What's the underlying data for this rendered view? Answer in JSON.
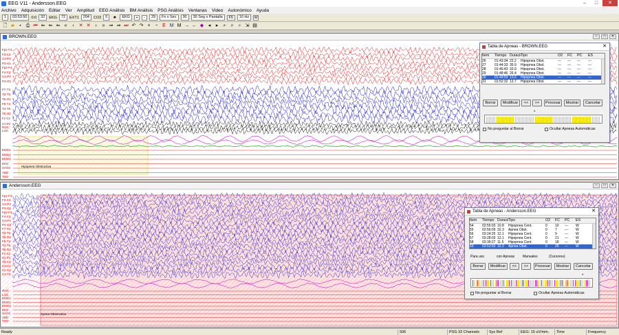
{
  "app": {
    "title": "EEG V11 - Andersson.EEG"
  },
  "menu": [
    "Archivo",
    "Adquisición",
    "Editar",
    "Ver",
    "Amplitud",
    "EEG Análisis",
    "BM Análisis",
    "PSG Análisis",
    "Ventanas",
    "Video",
    "Autonómico",
    "Ayuda"
  ],
  "toolbar1": {
    "page": "1",
    "time": "03:53:50",
    "v1": "0:0",
    "v2": "32",
    "ekg": "EKG",
    "v3": "72",
    "ext1": "EXT1",
    "v4": "204",
    "co2": "CO2",
    "v5": "0",
    "ekg2": "EKG",
    "v6": "29",
    "fxsec": "Fx x Sec",
    "v7": "30",
    "secpantalla": "30 Seg x Pantalla",
    "f5": "F5",
    "hz": "10 Hz",
    "w": "W"
  },
  "colors": {
    "red": "#e02020",
    "blue": "#1a1acc",
    "black": "#111111",
    "magenta": "#cc22cc",
    "green": "#22aa22",
    "selection": "#3366cc",
    "yellow": "#e8d800"
  },
  "window1": {
    "title": "BROWN.EEG",
    "annotation": "Hipopnea Obstructiva"
  },
  "window2": {
    "title": "Andersson.EEG",
    "annotation": "Apnea Obstructiva"
  },
  "dialog1": {
    "title": "Tabla de Apneas - BROWN.EEG",
    "headers": [
      "Item",
      "Tiempo",
      "Duracion",
      "Tipo",
      "O2",
      "FC",
      "PC",
      "ES"
    ],
    "rows": [
      [
        "26",
        "01:43:34",
        "22.2",
        "Hipopnea Obst.",
        "---",
        "---",
        "---",
        "---"
      ],
      [
        "27",
        "01:44:33",
        "35.9",
        "Hipopnea Obst.",
        "---",
        "---",
        "---",
        "---"
      ],
      [
        "28",
        "01:46:43",
        "33.9",
        "Hipopnea Obst.",
        "---",
        "---",
        "---",
        "---"
      ],
      [
        "29",
        "01:48:46",
        "26.4",
        "Hipopnea Obst.",
        "---",
        "---",
        "---",
        "---"
      ],
      [
        "30",
        "01:49:59",
        "13.6",
        "Hipopnea Obst.",
        "---",
        "---",
        "---",
        "---"
      ],
      [
        "31",
        "01:52:32",
        "13.7",
        "Hipopnea Obst.",
        "---",
        "---",
        "---",
        "---"
      ]
    ],
    "selected_index": 4,
    "buttons": [
      "Borrar",
      "Modificar",
      "<<",
      ">>",
      "Procesar",
      "Mostrar",
      "Cancelar"
    ],
    "chk_delete": "No preguntar al Borrar",
    "chk_hide": "Ocultar Apneas Automáticas",
    "marker": "*"
  },
  "dialog2": {
    "title": "Tabla de Apneas - Andersson.EEG",
    "headers": [
      "Item",
      "Tiempo",
      "Duracion",
      "Tipo",
      "O2",
      "FC",
      "PC",
      "ES"
    ],
    "rows": [
      [
        "54",
        "02:55:03",
        "10.8",
        "Hipopnea Cent.",
        "0",
        "10",
        "---",
        "W"
      ],
      [
        "55",
        "02:56:09",
        "32.3",
        "Apnea Obst.",
        "0",
        "7",
        "---",
        "W"
      ],
      [
        "56",
        "03:24:25",
        "12.1",
        "Hipopnea Cent.",
        "0",
        "9",
        "---",
        "W"
      ],
      [
        "57",
        "03:28:03",
        "12.1",
        "Hipopnea Cent.",
        "0",
        "21",
        "---",
        "W"
      ],
      [
        "58",
        "03:39:27",
        "11.5",
        "Hipopnea Cent.",
        "0",
        "18",
        "---",
        "W"
      ],
      [
        "59",
        "03:53:50",
        "32.3",
        "Apnea Obst.",
        "0",
        "26",
        "---",
        "W"
      ]
    ],
    "selected_index": 5,
    "radios": [
      "Para uso",
      "con Apneas",
      "Manuales",
      "(Cursores)"
    ],
    "buttons": [
      "Borrar",
      "Modificar",
      "<<",
      ">>",
      "Procesar",
      "Mostrar",
      "Cancelar"
    ],
    "chk_delete": "No preguntar al Borrar",
    "chk_hide": "Ocultar Apneas Automáticas",
    "marker": "*"
  },
  "status": {
    "ready": "Ready",
    "n": "936",
    "psg": "PSG 32 Channels",
    "sysref": "Sys Ref",
    "eeg": "EEG: 15 uV/mm.",
    "time": "Time",
    "freq": "Frequency"
  }
}
